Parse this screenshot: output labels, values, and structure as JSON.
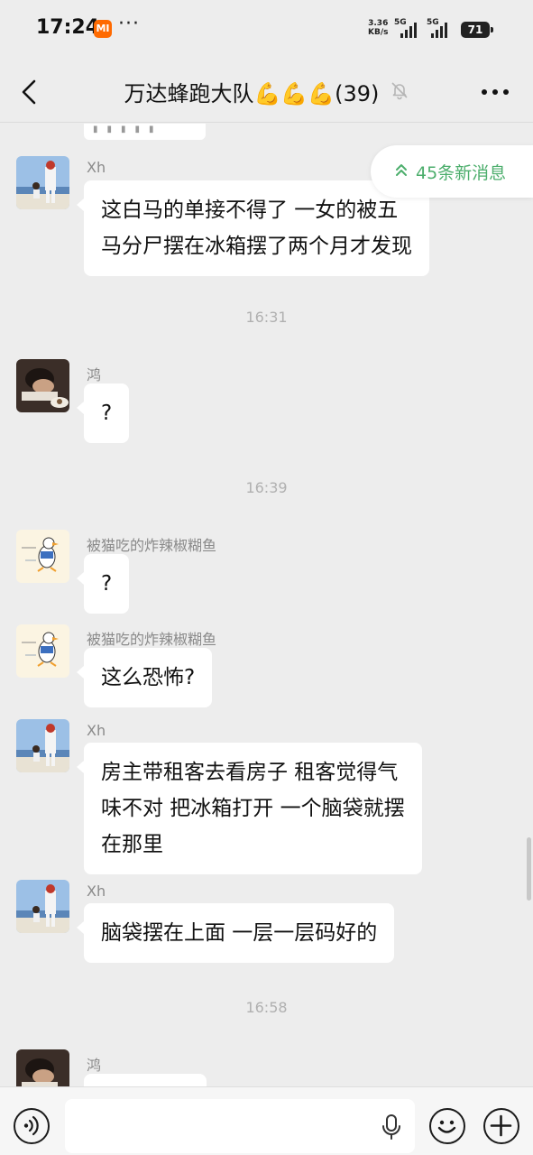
{
  "status_bar": {
    "time": "17:24",
    "mi_label": "MI",
    "dots": "···",
    "net_speed_value": "3.36",
    "net_speed_unit": "KB/s",
    "sig1_label": "5G",
    "sig2_label": "5G",
    "battery": "71"
  },
  "header": {
    "title": "万达蜂跑大队💪💪💪(39)"
  },
  "new_messages": {
    "label": "45条新消息"
  },
  "messages": [
    {
      "sender": "Xh",
      "lines": [
        "这白马的单接不得了  一女的被五",
        "马分尸摆在冰箱摆了两个月才发现"
      ]
    },
    {
      "time": "16:31"
    },
    {
      "sender": "鸿",
      "lines": [
        "?"
      ]
    },
    {
      "time": "16:39"
    },
    {
      "sender": "被猫吃的炸辣椒糊鱼",
      "lines": [
        "?"
      ]
    },
    {
      "sender": "被猫吃的炸辣椒糊鱼",
      "lines": [
        "这么恐怖?"
      ]
    },
    {
      "sender": "Xh",
      "lines": [
        "房主带租客去看房子  租客觉得气",
        "味不对  把冰箱打开  一个脑袋就摆",
        "在那里"
      ]
    },
    {
      "sender": "Xh",
      "lines": [
        "脑袋摆在上面  一层一层码好的"
      ]
    },
    {
      "time": "16:58"
    },
    {
      "sender": "鸿",
      "lines": [
        ""
      ]
    }
  ],
  "input": {
    "placeholder": ""
  },
  "colors": {
    "background": "#ededed",
    "bubble": "#ffffff",
    "accent_green": "#4cae6c",
    "timestamp": "#b0b0b0"
  },
  "icons": [
    "back-icon",
    "more-icon",
    "mute-icon",
    "double-chevron-up-icon",
    "voice-icon",
    "mic-icon",
    "emoji-icon",
    "plus-icon"
  ]
}
